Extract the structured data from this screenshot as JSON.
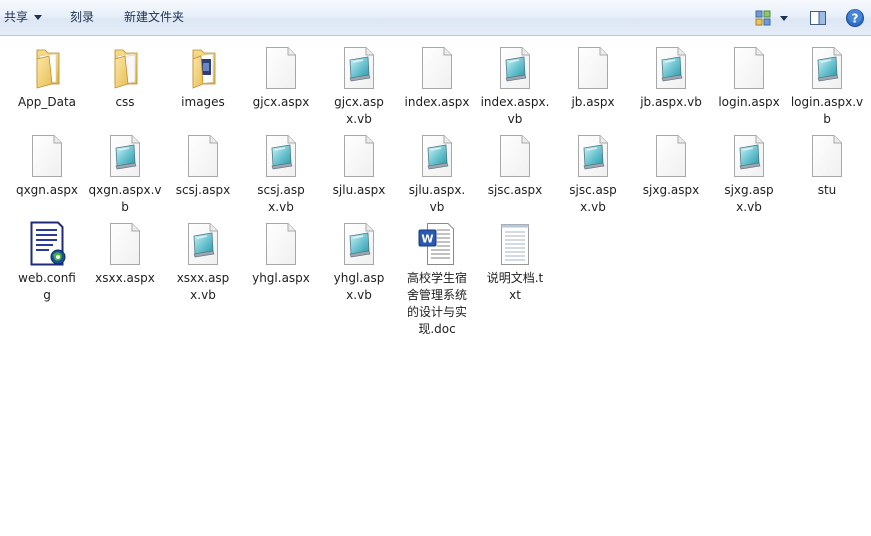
{
  "toolbar": {
    "share_label": "共享",
    "burn_label": "刻录",
    "new_folder_label": "新建文件夹"
  },
  "files": [
    {
      "name": "App_Data",
      "icon": "folder-icon"
    },
    {
      "name": "css",
      "icon": "folder-icon"
    },
    {
      "name": "images",
      "icon": "folder-images-icon"
    },
    {
      "name": "gjcx.aspx",
      "icon": "blank-file-icon"
    },
    {
      "name": "gjcx.aspx.vb",
      "icon": "vb-file-icon"
    },
    {
      "name": "index.aspx",
      "icon": "blank-file-icon"
    },
    {
      "name": "index.aspx.vb",
      "icon": "vb-file-icon"
    },
    {
      "name": "jb.aspx",
      "icon": "blank-file-icon"
    },
    {
      "name": "jb.aspx.vb",
      "icon": "vb-file-icon"
    },
    {
      "name": "login.aspx",
      "icon": "blank-file-icon"
    },
    {
      "name": "login.aspx.vb",
      "icon": "vb-file-icon"
    },
    {
      "name": "qxgn.aspx",
      "icon": "blank-file-icon"
    },
    {
      "name": "qxgn.aspx.vb",
      "icon": "vb-file-icon"
    },
    {
      "name": "scsj.aspx",
      "icon": "blank-file-icon"
    },
    {
      "name": "scsj.aspx.vb",
      "icon": "vb-file-icon"
    },
    {
      "name": "sjlu.aspx",
      "icon": "blank-file-icon"
    },
    {
      "name": "sjlu.aspx.vb",
      "icon": "vb-file-icon"
    },
    {
      "name": "sjsc.aspx",
      "icon": "blank-file-icon"
    },
    {
      "name": "sjsc.aspx.vb",
      "icon": "vb-file-icon"
    },
    {
      "name": "sjxg.aspx",
      "icon": "blank-file-icon"
    },
    {
      "name": "sjxg.aspx.vb",
      "icon": "vb-file-icon"
    },
    {
      "name": "stu",
      "icon": "blank-file-icon"
    },
    {
      "name": "web.config",
      "icon": "config-file-icon"
    },
    {
      "name": "xsxx.aspx",
      "icon": "blank-file-icon"
    },
    {
      "name": "xsxx.aspx.vb",
      "icon": "vb-file-icon"
    },
    {
      "name": "yhgl.aspx",
      "icon": "blank-file-icon"
    },
    {
      "name": "yhgl.aspx.vb",
      "icon": "vb-file-icon"
    },
    {
      "name": "高校学生宿舍管理系统的设计与实现.doc",
      "icon": "word-doc-icon"
    },
    {
      "name": "说明文档.txt",
      "icon": "text-file-icon"
    }
  ]
}
